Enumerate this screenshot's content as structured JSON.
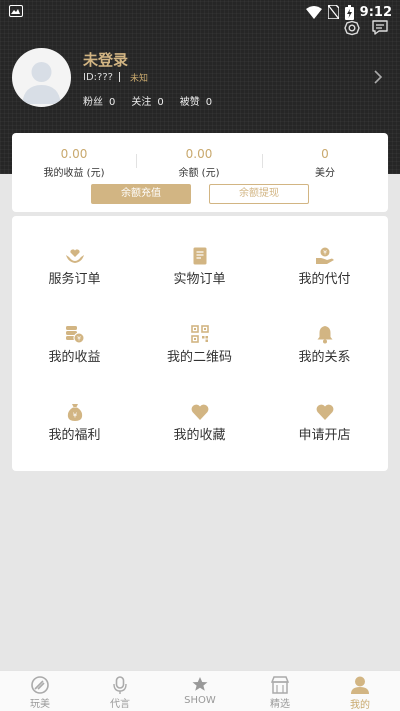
{
  "status_bar": {
    "time": "9:12"
  },
  "profile": {
    "name": "未登录",
    "id": "ID:???",
    "gender": "未知",
    "stats": [
      {
        "label": "粉丝",
        "value": "0"
      },
      {
        "label": "关注",
        "value": "0"
      },
      {
        "label": "被赞",
        "value": "0"
      }
    ]
  },
  "wallet": {
    "items": [
      {
        "value": "0.00",
        "label": "我的收益 (元)"
      },
      {
        "value": "0.00",
        "label": "余额 (元)"
      },
      {
        "value": "0",
        "label": "美分"
      }
    ],
    "recharge_label": "余额充值",
    "withdraw_label": "余额提现"
  },
  "menu": {
    "items": [
      {
        "label": "服务订单",
        "icon": "heart-hand-icon"
      },
      {
        "label": "实物订单",
        "icon": "document-icon"
      },
      {
        "label": "我的代付",
        "icon": "money-hand-icon"
      },
      {
        "label": "我的收益",
        "icon": "coins-icon"
      },
      {
        "label": "我的二维码",
        "icon": "qr-code-icon"
      },
      {
        "label": "我的关系",
        "icon": "bell-icon"
      },
      {
        "label": "我的福利",
        "icon": "money-bag-icon"
      },
      {
        "label": "我的收藏",
        "icon": "heart-icon"
      },
      {
        "label": "申请开店",
        "icon": "heart-icon"
      }
    ]
  },
  "tabbar": {
    "items": [
      {
        "label": "玩美",
        "icon": "brush-icon"
      },
      {
        "label": "代言",
        "icon": "microphone-icon"
      },
      {
        "label": "SHOW",
        "icon": "star-icon"
      },
      {
        "label": "精选",
        "icon": "store-icon"
      },
      {
        "label": "我的",
        "icon": "user-icon"
      }
    ],
    "active": "我的"
  },
  "colors": {
    "accent": "#d2b583",
    "header_bg": "#262626",
    "page_bg": "#e6e6e6"
  }
}
